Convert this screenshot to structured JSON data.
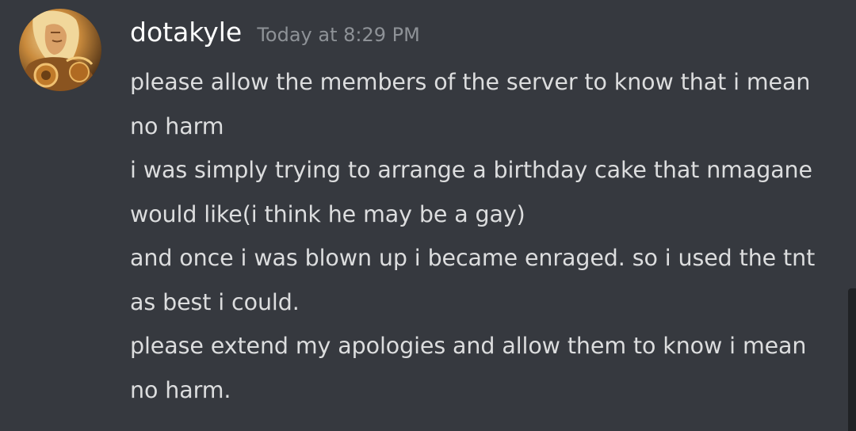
{
  "message_group": {
    "username": "dotakyle",
    "timestamp": "Today at 8:29 PM",
    "avatar_icon": "warrior-character-avatar-icon",
    "messages": [
      "please allow the members of the server to know that i mean no harm",
      "i was simply trying to arrange a birthday cake that nmagane would like(i think he may be a gay)",
      "and once i was blown up i became enraged. so i used the tnt as best i could.",
      "please extend my apologies and allow them to know i mean no harm."
    ]
  },
  "colors": {
    "background": "#36393f",
    "username": "#ffffff",
    "timestamp": "#8e9297",
    "message_text": "#dcddde",
    "scrollbar": "#202225"
  }
}
